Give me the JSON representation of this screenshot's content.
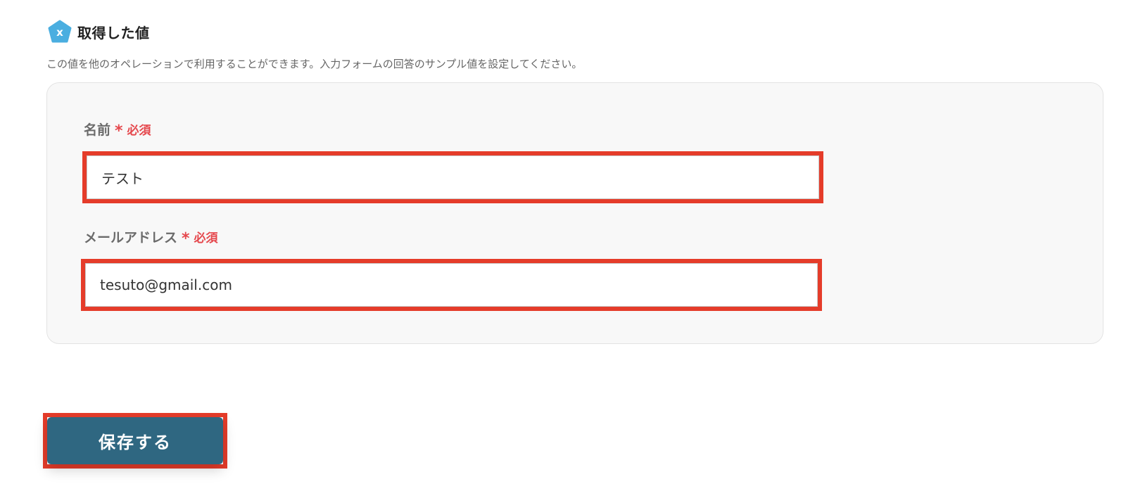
{
  "section": {
    "icon": "pentagon-x-icon",
    "title": "取得した値",
    "description": "この値を他のオペレーションで利用することができます。入力フォームの回答のサンプル値を設定してください。"
  },
  "form": {
    "fields": [
      {
        "label": "名前",
        "required_star": "*",
        "required_text": "必須",
        "value": "テスト"
      },
      {
        "label": "メールアドレス",
        "required_star": "*",
        "required_text": "必須",
        "value": "tesuto@gmail.com"
      }
    ]
  },
  "actions": {
    "save_label": "保存する"
  },
  "colors": {
    "accent_icon": "#4aaee0",
    "required": "#e5484d",
    "highlight": "#e53c2a",
    "save_button": "#2f6781"
  }
}
